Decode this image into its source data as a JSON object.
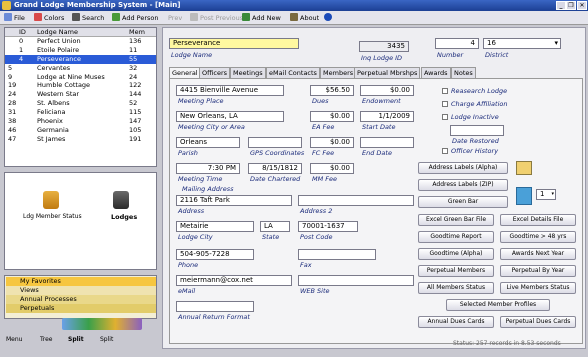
{
  "window": {
    "title": "Grand Lodge Membership System - [Main]"
  },
  "toolbar": {
    "file": "File",
    "colors": "Colors",
    "search": "Search",
    "add_person": "Add Person",
    "prev": "Prev",
    "post_previous": "Post Previous",
    "add_new": "Add New",
    "about": "About"
  },
  "list": {
    "headers": {
      "id": "ID",
      "name": "Lodge Name",
      "mem": "Mem"
    },
    "rows": [
      {
        "marker": "",
        "id": "0",
        "name": "Perfect Union",
        "mem": "136"
      },
      {
        "marker": "",
        "id": "1",
        "name": "Etoile Polaire",
        "mem": "11"
      },
      {
        "marker": "",
        "id": "4",
        "name": "Perseverance",
        "mem": "55"
      },
      {
        "marker": "5",
        "id": "",
        "name": "Cervantes",
        "mem": "32"
      },
      {
        "marker": "9",
        "id": "",
        "name": "Lodge at Nine Muses",
        "mem": "24"
      },
      {
        "marker": "19",
        "id": "",
        "name": "Humble Cottage",
        "mem": "122"
      },
      {
        "marker": "24",
        "id": "",
        "name": "Western Star",
        "mem": "144"
      },
      {
        "marker": "28",
        "id": "",
        "name": "St. Albens",
        "mem": "52"
      },
      {
        "marker": "31",
        "id": "",
        "name": "Feliciana",
        "mem": "115"
      },
      {
        "marker": "38",
        "id": "",
        "name": "Phoenix",
        "mem": "147"
      },
      {
        "marker": "46",
        "id": "",
        "name": "Germania",
        "mem": "105"
      },
      {
        "marker": "47",
        "id": "",
        "name": "St James",
        "mem": "191"
      }
    ],
    "selected_index": 2
  },
  "level": {
    "member_status": "Ldg Member Status",
    "lodges": "Lodges"
  },
  "nav": {
    "favorites": "My Favorites",
    "views": "Views",
    "annual": "Annual Processes",
    "perpetual": "Perpetuals"
  },
  "bottom": {
    "menu": "Menu",
    "tree": "Tree",
    "split": "Split",
    "split2": "Split"
  },
  "header": {
    "lodge_name": "Perseverance",
    "lodge_name_label": "Lodge Name",
    "inq_id": "3435",
    "inq_id_label": "Inq Lodge ID",
    "number": "4",
    "number_label": "Number",
    "district": "16",
    "district_label": "District"
  },
  "tabs": [
    "General",
    "Officers",
    "Meetings",
    "eMail Contacts",
    "Members",
    "Perpetual Mbrshps",
    "Awards",
    "Notes"
  ],
  "fields": {
    "meeting_place": "4415 Bienville Avenue",
    "meeting_place_label": "Meeting Place",
    "dues": "$56.50",
    "dues_label": "Dues",
    "endowment": "$0.00",
    "endowment_label": "Endowment",
    "city": "New Orleans, LA",
    "city_label": "Meeting City or Area",
    "ea_fee": "$0.00",
    "ea_fee_label": "EA Fee",
    "start_date": "1/1/2009",
    "start_date_label": "Start Date",
    "parish": "Orleans",
    "parish_label": "Parish",
    "gps_label": "GPS Coordinates",
    "fc_fee": "$0.00",
    "fc_fee_label": "FC Fee",
    "end_date_label": "End Date",
    "meeting_time": "7:30 PM",
    "meeting_time_label": "Meeting Time",
    "date_chartered": "8/15/1812",
    "date_chartered_label": "Date Chartered",
    "mm_fee": "$0.00",
    "mm_fee_label": "MM Fee",
    "mailing_label": "Mailing Address",
    "address": "2116 Taft Park",
    "address_label": "Address",
    "address2_label": "Address 2",
    "lodge_city": "Metairie",
    "lodge_city_label": "Lodge City",
    "state": "LA",
    "state_label": "State",
    "post_code": "70001-1637",
    "post_code_label": "Post Code",
    "phone": "504-905-7228",
    "phone_label": "Phone",
    "fax_label": "Fax",
    "email": "meiermann@cox.net",
    "email_label": "eMail",
    "web_label": "WEB Site",
    "annual_return_label": "Annual Return Format"
  },
  "checks": {
    "research": "Reasearch Lodge",
    "charge": "Charge Affiliation",
    "inactive": "Lodge Inactive",
    "date_restored": "Date Restored",
    "history": "Officer History"
  },
  "buttons": {
    "addr_alpha": "Address Labels (Alpha)",
    "addr_zip": "Address Labels (ZIP)",
    "green_bar": "Green Bar",
    "excel_green": "Excel Green Bar File",
    "excel_details": "Excel Details File",
    "goodtime_report": "Goodtime Report",
    "goodtime_48": "Goodtime > 48 yrs",
    "goodtime_alpha": "Goodtime (Alpha)",
    "awards_next": "Awards Next Year",
    "perp_members": "Perpetual Members",
    "perp_year": "Perpetual By Year",
    "all_status": "All Members Status",
    "live_status": "Live Members Status",
    "selected_profiles": "Selected Member Profiles",
    "annual_dues": "Annual Dues Cards",
    "perp_dues": "Perpetual Dues Cards",
    "copies": "1"
  },
  "status": "Status: 257 records in 8.53 seconds",
  "colors": {
    "title": "#2a55b8",
    "selection": "#2a5bd7",
    "label": "#1a2a7a",
    "lodge_name_field": "#fff8a0"
  }
}
